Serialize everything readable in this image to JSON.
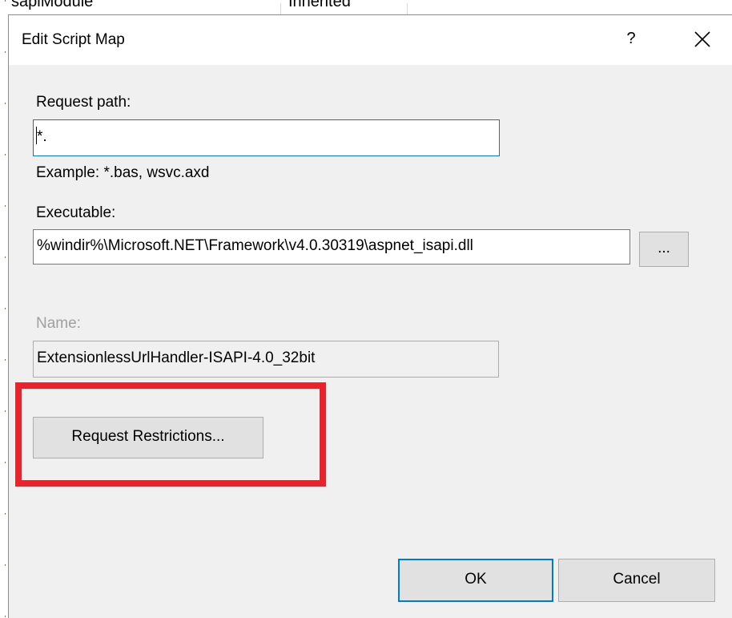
{
  "background": {
    "col1": "sapiModule",
    "col2": "Inherited"
  },
  "dialog": {
    "title": "Edit Script Map",
    "help_label": "?",
    "close_icon": "close-icon"
  },
  "request_path": {
    "label": "Request path:",
    "value": "*.",
    "example": "Example: *.bas, wsvc.axd"
  },
  "executable": {
    "label": "Executable:",
    "value": "%windir%\\Microsoft.NET\\Framework\\v4.0.30319\\aspnet_isapi.dll",
    "browse_label": "..."
  },
  "name": {
    "label": "Name:",
    "value": "ExtensionlessUrlHandler-ISAPI-4.0_32bit"
  },
  "restrictions": {
    "label": "Request Restrictions..."
  },
  "buttons": {
    "ok": "OK",
    "cancel": "Cancel"
  },
  "colors": {
    "accent": "#0078d7",
    "highlight": "#e8232c",
    "dialog_bg": "#f0f0f0"
  }
}
